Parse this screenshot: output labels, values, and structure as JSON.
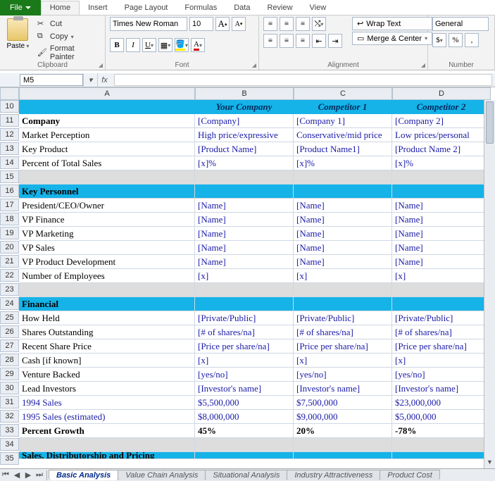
{
  "tabs": {
    "file": "File",
    "home": "Home",
    "insert": "Insert",
    "page_layout": "Page Layout",
    "formulas": "Formulas",
    "data": "Data",
    "review": "Review",
    "view": "View"
  },
  "ribbon": {
    "clipboard": {
      "label": "Clipboard",
      "paste": "Paste",
      "cut": "Cut",
      "copy": "Copy",
      "format_painter": "Format Painter"
    },
    "font": {
      "label": "Font",
      "family": "Times New Roman",
      "size": "10"
    },
    "alignment": {
      "label": "Alignment",
      "wrap": "Wrap Text",
      "merge": "Merge & Center"
    },
    "number": {
      "label": "Number",
      "format": "General"
    }
  },
  "namebox": "M5",
  "formula": "",
  "columns": [
    "A",
    "B",
    "C",
    "D"
  ],
  "header_row": {
    "b": "Your Company",
    "c": "Competitor 1",
    "d": "Competitor 2"
  },
  "rows": [
    {
      "n": 11,
      "a": "Company",
      "b": "[Company]",
      "c": "[Company 1]",
      "d": "[Company 2]",
      "bold": true
    },
    {
      "n": 12,
      "a": "Market Perception",
      "b": "High price/expressive",
      "c": "Conservative/mid price",
      "d": "Low prices/personal"
    },
    {
      "n": 13,
      "a": "Key Product",
      "b": "[Product Name]",
      "c": "[Product Name1]",
      "d": "[Product Name 2]"
    },
    {
      "n": 14,
      "a": "Percent of Total Sales",
      "b": "[x]%",
      "c": "[x]%",
      "d": "[x]%"
    }
  ],
  "sec2": "Key Personnel",
  "rows2": [
    {
      "n": 17,
      "a": "President/CEO/Owner",
      "b": "[Name]",
      "c": "[Name]",
      "d": "[Name]"
    },
    {
      "n": 18,
      "a": "VP Finance",
      "b": "[Name]",
      "c": "[Name]",
      "d": "[Name]"
    },
    {
      "n": 19,
      "a": "VP Marketing",
      "b": "[Name]",
      "c": "[Name]",
      "d": "[Name]"
    },
    {
      "n": 20,
      "a": "VP Sales",
      "b": "[Name]",
      "c": "[Name]",
      "d": "[Name]"
    },
    {
      "n": 21,
      "a": "VP Product Development",
      "b": "[Name]",
      "c": "[Name]",
      "d": "[Name]"
    },
    {
      "n": 22,
      "a": "Number of Employees",
      "b": "[x]",
      "c": "[x]",
      "d": "[x]"
    }
  ],
  "sec3": "Financial",
  "rows3": [
    {
      "n": 25,
      "a": "How Held",
      "b": "[Private/Public]",
      "c": "[Private/Public]",
      "d": "[Private/Public]"
    },
    {
      "n": 26,
      "a": "Shares Outstanding",
      "b": "[# of shares/na]",
      "c": "[# of shares/na]",
      "d": "[# of shares/na]"
    },
    {
      "n": 27,
      "a": "Recent Share Price",
      "b": "[Price per share/na]",
      "c": "[Price per share/na]",
      "d": "[Price per share/na]"
    },
    {
      "n": 28,
      "a": "Cash [if known]",
      "b": "[x]",
      "c": "[x]",
      "d": "[x]"
    },
    {
      "n": 29,
      "a": "Venture Backed",
      "b": "[yes/no]",
      "c": "[yes/no]",
      "d": "[yes/no]"
    },
    {
      "n": 30,
      "a": "Lead Investors",
      "b": "[Investor's name]",
      "c": "[Investor's name]",
      "d": "[Investor's name]"
    },
    {
      "n": 31,
      "a": "1994 Sales",
      "b": "$5,500,000",
      "c": "$7,500,000",
      "d": "$23,000,000",
      "aval": true
    },
    {
      "n": 32,
      "a": "1995 Sales (estimated)",
      "b": "$8,000,000",
      "c": "$9,000,000",
      "d": "$5,000,000",
      "aval": true
    },
    {
      "n": 33,
      "a": "Percent Growth",
      "b": "45%",
      "c": "20%",
      "d": "-78%",
      "bold": true,
      "plain": true
    }
  ],
  "sec4": "Sales, Distributorship and Pricing",
  "sheet_tabs": [
    "Basic Analysis",
    "Value Chain Analysis",
    "Situational Analysis",
    "Industry Attractiveness",
    "Product Cost"
  ]
}
